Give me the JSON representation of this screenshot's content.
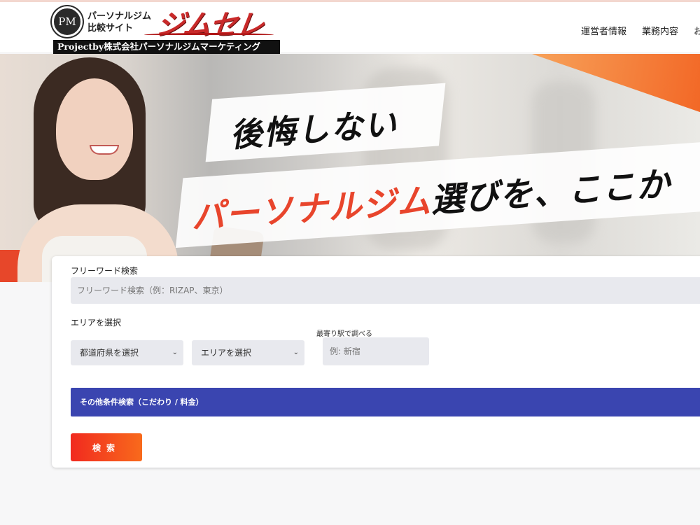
{
  "header": {
    "logo_emblem": "PM",
    "logo_sub": "パーソナルジム\n比較サイト",
    "logo_main": "ジムセレ",
    "logo_bar": "Projectby株式会社パーソナルジムマーケティング",
    "nav": [
      "運営者情報",
      "業務内容",
      "お"
    ]
  },
  "hero": {
    "line1": "後悔しない",
    "line2_accent": "パーソナルジム",
    "line2_rest": "選びを、ここか"
  },
  "search": {
    "freeword_label": "フリーワード検索",
    "freeword_placeholder": "フリーワード検索（例：RIZAP、東京）",
    "area_label": "エリアを選択",
    "prefecture_select": "都道府県を選択",
    "area_select": "エリアを選択",
    "station_label": "最寄り駅で調べる",
    "station_placeholder": "例: 新宿",
    "more_conditions": "その他条件検索（こだわり / 料金）",
    "search_button": "検索"
  }
}
